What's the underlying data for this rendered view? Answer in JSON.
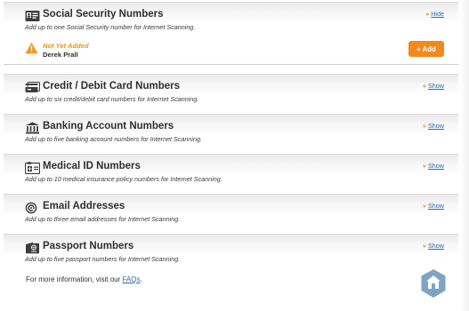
{
  "sections": [
    {
      "id": "ssn",
      "title": "Social Security Numbers",
      "description": "Add up to one Social Security number for Internet Scanning.",
      "toggle_arrows": "»",
      "toggle_label": "Hide",
      "icon": "id-card-icon"
    },
    {
      "id": "credit",
      "title": "Credit / Debit Card Numbers",
      "description": "Add up to six credit/debit card numbers for Internet Scanning.",
      "toggle_arrows": "»",
      "toggle_label": "Show",
      "icon": "credit-card-icon"
    },
    {
      "id": "bank",
      "title": "Banking Account Numbers",
      "description": "Add up to five banking account numbers for Internet Scanning.",
      "toggle_arrows": "»",
      "toggle_label": "Show",
      "icon": "bank-icon"
    },
    {
      "id": "medical",
      "title": "Medical ID Numbers",
      "description": "Add up to 10 medical insurance policy numbers for Internet Scanning.",
      "toggle_arrows": "»",
      "toggle_label": "Show",
      "icon": "medical-id-icon"
    },
    {
      "id": "email",
      "title": "Email Addresses",
      "description": "Add up to three email addresses for Internet Scanning.",
      "toggle_arrows": "»",
      "toggle_label": "Show",
      "icon": "at-sign-icon"
    },
    {
      "id": "passport",
      "title": "Passport Numbers",
      "description": "Add up to five passport numbers for Internet Scanning.",
      "toggle_arrows": "»",
      "toggle_label": "Show",
      "icon": "passport-icon"
    }
  ],
  "ssn_item": {
    "status": "Not Yet Added",
    "name": "Derek Prall",
    "add_label": "+ Add",
    "icon": "warning-icon"
  },
  "footer": {
    "prefix": "For more information, visit our ",
    "link": "FAQs",
    "suffix": "."
  },
  "colors": {
    "accent": "#f18a1d",
    "link": "#2b6cb0",
    "warning": "#e8941b",
    "brand_badge": "#7fa3c4"
  }
}
